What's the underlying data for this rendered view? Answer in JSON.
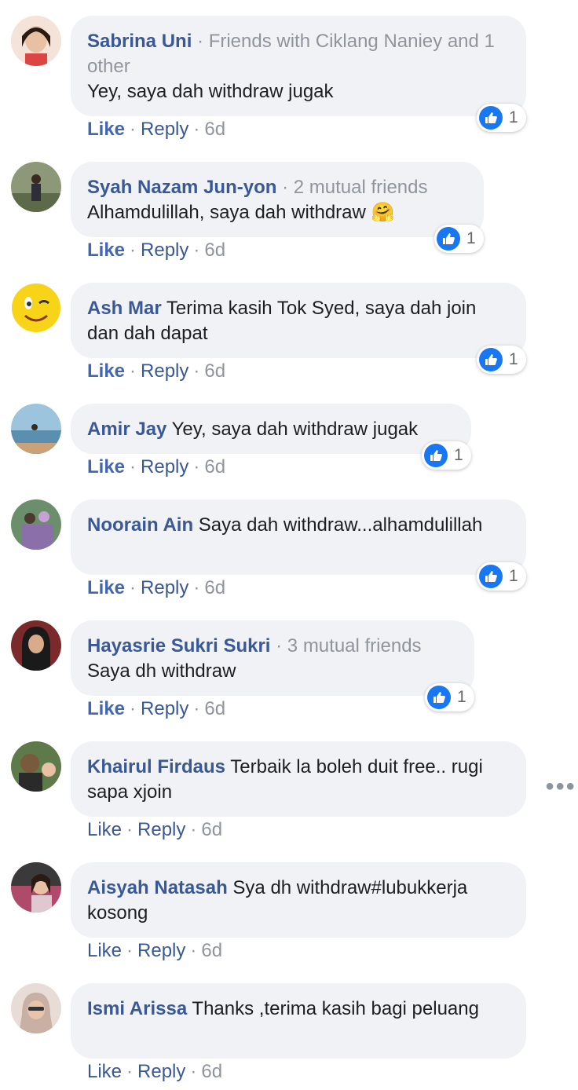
{
  "comments": [
    {
      "name": "Sabrina Uni",
      "meta": " · Friends with Ciklang Naniey and 1 other",
      "text": "Yey, saya dah withdraw jugak",
      "like": "Like",
      "reply": "Reply",
      "time": "6d",
      "reactions": "1",
      "avatar_color": "#e9c9b5"
    },
    {
      "name": "Syah Nazam Jun-yon",
      "meta": " · 2 mutual friends",
      "text": "Alhamdulillah, saya dah withdraw ",
      "emoji": "🤗",
      "like": "Like",
      "reply": "Reply",
      "time": "6d",
      "reactions": "1",
      "avatar_color": "#6e7a5a"
    },
    {
      "name": "Ash Mar",
      "meta": "",
      "text": "Terima kasih Tok Syed, saya dah join dan dah dapat",
      "like": "Like",
      "reply": "Reply",
      "time": "6d",
      "reactions": "1",
      "avatar_color": "#f5d020"
    },
    {
      "name": "Amir Jay",
      "meta": "",
      "text": "Yey, saya dah withdraw jugak",
      "like": "Like",
      "reply": "Reply",
      "time": "6d",
      "reactions": "1",
      "avatar_color": "#5b8fb0"
    },
    {
      "name": "Noorain Ain",
      "meta": "",
      "text": "Saya dah withdraw...alhamdulillah",
      "like": "Like",
      "reply": "Reply",
      "time": "6d",
      "reactions": "1",
      "avatar_color": "#8a6fa8"
    },
    {
      "name": "Hayasrie Sukri Sukri",
      "meta": " · 3 mutual friends",
      "text": "Saya dh withdraw",
      "like": "Like",
      "reply": "Reply",
      "time": "6d",
      "reactions": "1",
      "avatar_color": "#2b2b2b"
    },
    {
      "name": "Khairul Firdaus",
      "meta": "",
      "text": "Terbaik la boleh duit free.. rugi sapa xjoin",
      "like": "Like",
      "reply": "Reply",
      "time": "6d",
      "reactions": "",
      "avatar_color": "#7a5a3c"
    },
    {
      "name": "Aisyah Natasah",
      "meta": "",
      "text": "Sya dh withdraw#lubukkerja kosong",
      "like": "Like",
      "reply": "Reply",
      "time": "6d",
      "reactions": "",
      "avatar_color": "#c7577a"
    },
    {
      "name": "Ismi Arissa",
      "meta": "",
      "text": "Thanks ,terima kasih bagi peluang",
      "like": "Like",
      "reply": "Reply",
      "time": "6d",
      "reactions": "",
      "avatar_color": "#d8c2b6"
    }
  ],
  "more_icon": "more-horizontal-icon",
  "colors": {
    "name": "#385898",
    "like_active": "#4267b2",
    "meta": "#90949c",
    "bubble": "#f0f2f5",
    "reaction": "#1877f2"
  }
}
